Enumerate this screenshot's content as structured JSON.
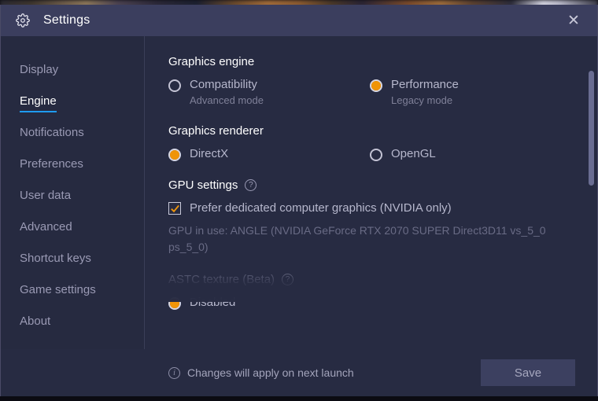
{
  "window": {
    "title": "Settings",
    "gear_icon": "gear-icon",
    "close_label": "✕"
  },
  "sidebar": {
    "items": [
      {
        "label": "Display",
        "active": false
      },
      {
        "label": "Engine",
        "active": true
      },
      {
        "label": "Notifications",
        "active": false
      },
      {
        "label": "Preferences",
        "active": false
      },
      {
        "label": "User data",
        "active": false
      },
      {
        "label": "Advanced",
        "active": false
      },
      {
        "label": "Shortcut keys",
        "active": false
      },
      {
        "label": "Game settings",
        "active": false
      },
      {
        "label": "About",
        "active": false
      }
    ]
  },
  "main": {
    "graphics_engine": {
      "title": "Graphics engine",
      "options": [
        {
          "label": "Compatibility",
          "sub": "Advanced mode",
          "checked": false
        },
        {
          "label": "Performance",
          "sub": "Legacy mode",
          "checked": true
        }
      ]
    },
    "graphics_renderer": {
      "title": "Graphics renderer",
      "options": [
        {
          "label": "DirectX",
          "checked": true
        },
        {
          "label": "OpenGL",
          "checked": false
        }
      ]
    },
    "gpu_settings": {
      "title": "GPU settings",
      "help_icon": "help-icon",
      "help_glyph": "?",
      "checkbox": {
        "label": "Prefer dedicated computer graphics (NVIDIA only)",
        "checked": true
      },
      "gpu_in_use": "GPU in use: ANGLE (NVIDIA GeForce RTX 2070 SUPER Direct3D11 vs_5_0 ps_5_0)"
    },
    "astc_texture": {
      "title": "ASTC texture (Beta)",
      "help_glyph": "?",
      "options": [
        {
          "label": "Disabled",
          "checked": true
        }
      ]
    }
  },
  "footer": {
    "info_icon": "info-icon",
    "info_glyph": "i",
    "note": "Changes will apply on next launch",
    "save_label": "Save"
  },
  "colors": {
    "accent_orange": "#f09407",
    "accent_blue": "#1f9bf0",
    "dialog_bg": "#272b42",
    "titlebar_bg": "#3b3e5e",
    "sidebar_bg": "#262a40"
  }
}
